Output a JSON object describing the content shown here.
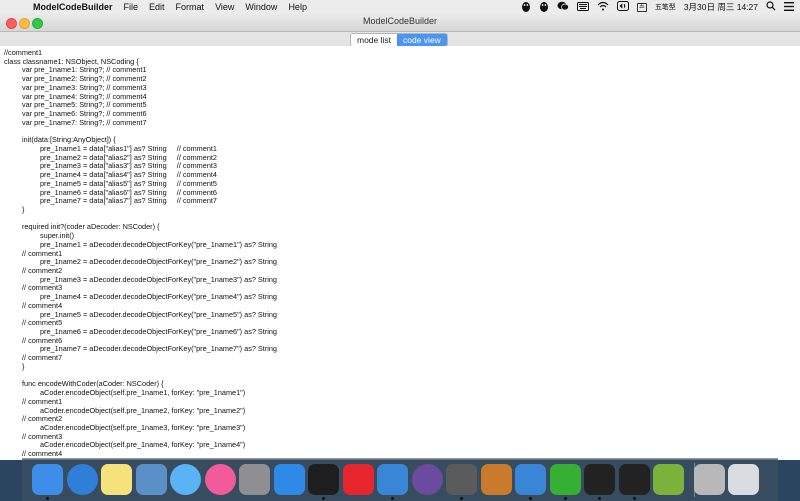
{
  "menubar": {
    "apple_glyph": "",
    "app_name": "ModelCodeBuilder",
    "items": [
      "File",
      "Edit",
      "Format",
      "View",
      "Window",
      "Help"
    ],
    "ime_label": "五笔型",
    "datetime": "3月30日 周三 14:27"
  },
  "window": {
    "title": "ModelCodeBuilder",
    "tabs": [
      "mode list",
      "code view"
    ],
    "active_tab": "code view"
  },
  "code_lines": [
    "//comment1",
    "class classname1: NSObject, NSCoding {",
    "\tvar pre_1name1: String?; // comment1",
    "\tvar pre_1name2: String?; // comment2",
    "\tvar pre_1name3: String?; // comment3",
    "\tvar pre_1name4: String?; // comment4",
    "\tvar pre_1name5: String?; // comment5",
    "\tvar pre_1name6: String?; // comment6",
    "\tvar pre_1name7: String?; // comment7",
    "",
    "\tinit(data:[String:AnyObject]) {",
    "\t\tpre_1name1 = data[\"alias1\"] as? String     // comment1",
    "\t\tpre_1name2 = data[\"alias2\"] as? String     // comment2",
    "\t\tpre_1name3 = data[\"alias3\"] as? String     // comment3",
    "\t\tpre_1name4 = data[\"alias4\"] as? String     // comment4",
    "\t\tpre_1name5 = data[\"alias5\"] as? String     // comment5",
    "\t\tpre_1name6 = data[\"alias6\"] as? String     // comment6",
    "\t\tpre_1name7 = data[\"alias7\"] as? String     // comment7",
    "\t}",
    "",
    "\trequired init?(coder aDecoder: NSCoder) {",
    "\t\tsuper.init()",
    "\t\tpre_1name1 = aDecoder.decodeObjectForKey(\"pre_1name1\") as? String",
    "\t// comment1",
    "\t\tpre_1name2 = aDecoder.decodeObjectForKey(\"pre_1name2\") as? String",
    "\t// comment2",
    "\t\tpre_1name3 = aDecoder.decodeObjectForKey(\"pre_1name3\") as? String",
    "\t// comment3",
    "\t\tpre_1name4 = aDecoder.decodeObjectForKey(\"pre_1name4\") as? String",
    "\t// comment4",
    "\t\tpre_1name5 = aDecoder.decodeObjectForKey(\"pre_1name5\") as? String",
    "\t// comment5",
    "\t\tpre_1name6 = aDecoder.decodeObjectForKey(\"pre_1name6\") as? String",
    "\t// comment6",
    "\t\tpre_1name7 = aDecoder.decodeObjectForKey(\"pre_1name7\") as? String",
    "\t// comment7",
    "\t}",
    "",
    "\tfunc encodeWithCoder(aCoder: NSCoder) {",
    "\t\taCoder.encodeObject(self.pre_1name1, forKey: \"pre_1name1\")",
    "\t// comment1",
    "\t\taCoder.encodeObject(self.pre_1name2, forKey: \"pre_1name2\")",
    "\t// comment2",
    "\t\taCoder.encodeObject(self.pre_1name3, forKey: \"pre_1name3\")",
    "\t// comment3",
    "\t\taCoder.encodeObject(self.pre_1name4, forKey: \"pre_1name4\")",
    "\t// comment4"
  ],
  "tray_icons": [
    "qq-penguin-icon",
    "qq-penguin-icon",
    "wechat-icon",
    "keyboard-icon",
    "wifi-icon",
    "audio-icon",
    "ime-icon"
  ],
  "dock": [
    {
      "name": "finder-icon",
      "color": "#3d8ee8",
      "running": true
    },
    {
      "name": "safari-icon",
      "color": "#2f7fd8",
      "running": false
    },
    {
      "name": "notes-icon",
      "color": "#f6e27a",
      "running": false
    },
    {
      "name": "preview-icon",
      "color": "#5a8fc8",
      "running": false
    },
    {
      "name": "messages-icon",
      "color": "#5ab3f5",
      "running": false
    },
    {
      "name": "itunes-icon",
      "color": "#f35a9b",
      "running": false
    },
    {
      "name": "system-preferences-icon",
      "color": "#8e8e93",
      "running": false
    },
    {
      "name": "appstore-icon",
      "color": "#2e8ae6",
      "running": false
    },
    {
      "name": "terminal-icon",
      "color": "#1e1e1e",
      "running": true
    },
    {
      "name": "weibo-icon",
      "color": "#e6252d",
      "running": false
    },
    {
      "name": "xcode-icon",
      "color": "#3a86d6",
      "running": true
    },
    {
      "name": "github-icon",
      "color": "#6c4a9e",
      "running": false
    },
    {
      "name": "sublime-text-icon",
      "color": "#5b5b5b",
      "running": true
    },
    {
      "name": "box-icon",
      "color": "#c97a2a",
      "running": false
    },
    {
      "name": "xcode-alt-icon",
      "color": "#3a86d6",
      "running": true
    },
    {
      "name": "wechat-icon",
      "color": "#35b034",
      "running": true
    },
    {
      "name": "qq-icon",
      "color": "#222222",
      "running": true
    },
    {
      "name": "qq-icon",
      "color": "#222222",
      "running": true
    },
    {
      "name": "android-icon",
      "color": "#7bb33a",
      "running": false
    },
    {
      "name": "photo-booth-icon",
      "color": "#b8b8b8",
      "running": false
    },
    {
      "name": "trash-icon",
      "color": "#d9dde2",
      "running": false
    }
  ]
}
